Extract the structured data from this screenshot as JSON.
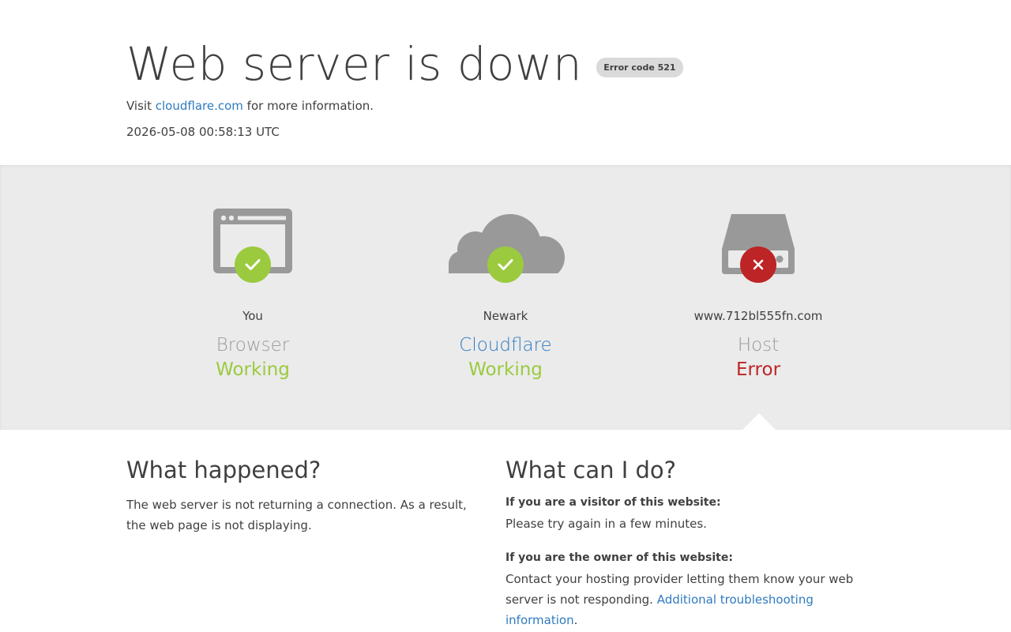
{
  "header": {
    "title": "Web server is down",
    "error_badge": "Error code 521",
    "visit_prefix": "Visit",
    "visit_link": "cloudflare.com",
    "visit_suffix": "for more information.",
    "timestamp": "2026-05-08 00:58:13 UTC"
  },
  "status": [
    {
      "location": "You",
      "service": "Browser",
      "state": "Working",
      "icon": "browser-icon",
      "result": "ok"
    },
    {
      "location": "Newark",
      "service": "Cloudflare",
      "state": "Working",
      "icon": "cloud-icon",
      "result": "ok"
    },
    {
      "location": "www.712bl555fn.com",
      "service": "Host",
      "state": "Error",
      "icon": "server-icon",
      "result": "error"
    }
  ],
  "what_happened": {
    "title": "What happened?",
    "text": "The web server is not returning a connection. As a result, the web page is not displaying."
  },
  "what_can_i_do": {
    "title": "What can I do?",
    "visitor_heading": "If you are a visitor of this website:",
    "visitor_text": "Please try again in a few minutes.",
    "owner_heading": "If you are the owner of this website:",
    "owner_text": "Contact your hosting provider letting them know your web server is not responding.",
    "owner_link": "Additional troubleshooting information",
    "owner_suffix": "."
  },
  "colors": {
    "ok": "#9bca3e",
    "error": "#bd2426",
    "link": "#2f7bbf",
    "icon_gray": "#999999",
    "band_bg": "#ebebeb"
  }
}
